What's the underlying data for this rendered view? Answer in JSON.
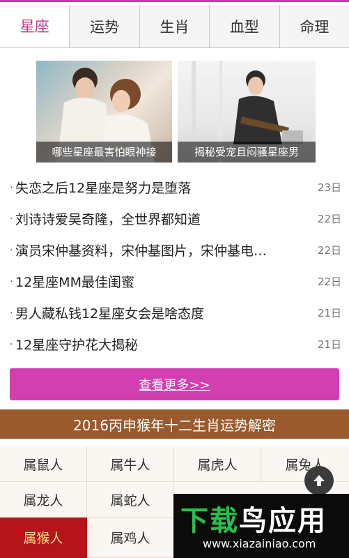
{
  "tabs": [
    {
      "label": "星座"
    },
    {
      "label": "运势"
    },
    {
      "label": "生肖"
    },
    {
      "label": "血型"
    },
    {
      "label": "命理"
    }
  ],
  "active_tab": "星座",
  "accent_color": "#c93aa4",
  "featured": [
    {
      "caption": "哪些星座最害怕眼神接"
    },
    {
      "caption": "揭秘受宠且闷骚星座男"
    }
  ],
  "news": [
    {
      "title": "失恋之后12星座是努力是堕落",
      "day": "23日"
    },
    {
      "title": "刘诗诗爱吴奇隆，全世界都知道",
      "day": "22日"
    },
    {
      "title": "演员宋仲基资料，宋仲基图片，宋仲基电…",
      "day": "22日"
    },
    {
      "title": "12星座MM最佳闺蜜",
      "day": "22日"
    },
    {
      "title": "男人藏私钱12星座女会是啥态度",
      "day": "21日"
    },
    {
      "title": "12星座守护花大揭秘",
      "day": "21日"
    }
  ],
  "more_label": "查看更多>>",
  "banner_title": "2016丙申猴年十二生肖运势解密",
  "zodiac": [
    {
      "label": "属鼠人"
    },
    {
      "label": "属牛人"
    },
    {
      "label": "属虎人"
    },
    {
      "label": "属兔人"
    },
    {
      "label": "属龙人"
    },
    {
      "label": "属蛇人"
    },
    {
      "label": "属猴人"
    },
    {
      "label": "属鸡人"
    }
  ],
  "active_zodiac": "属猴人",
  "watermark": {
    "text_green": "下载",
    "text_white": "鸟应用",
    "url": "www.xiazainiao.com"
  },
  "icons": {
    "back_to_top": "arrow-up-icon"
  }
}
